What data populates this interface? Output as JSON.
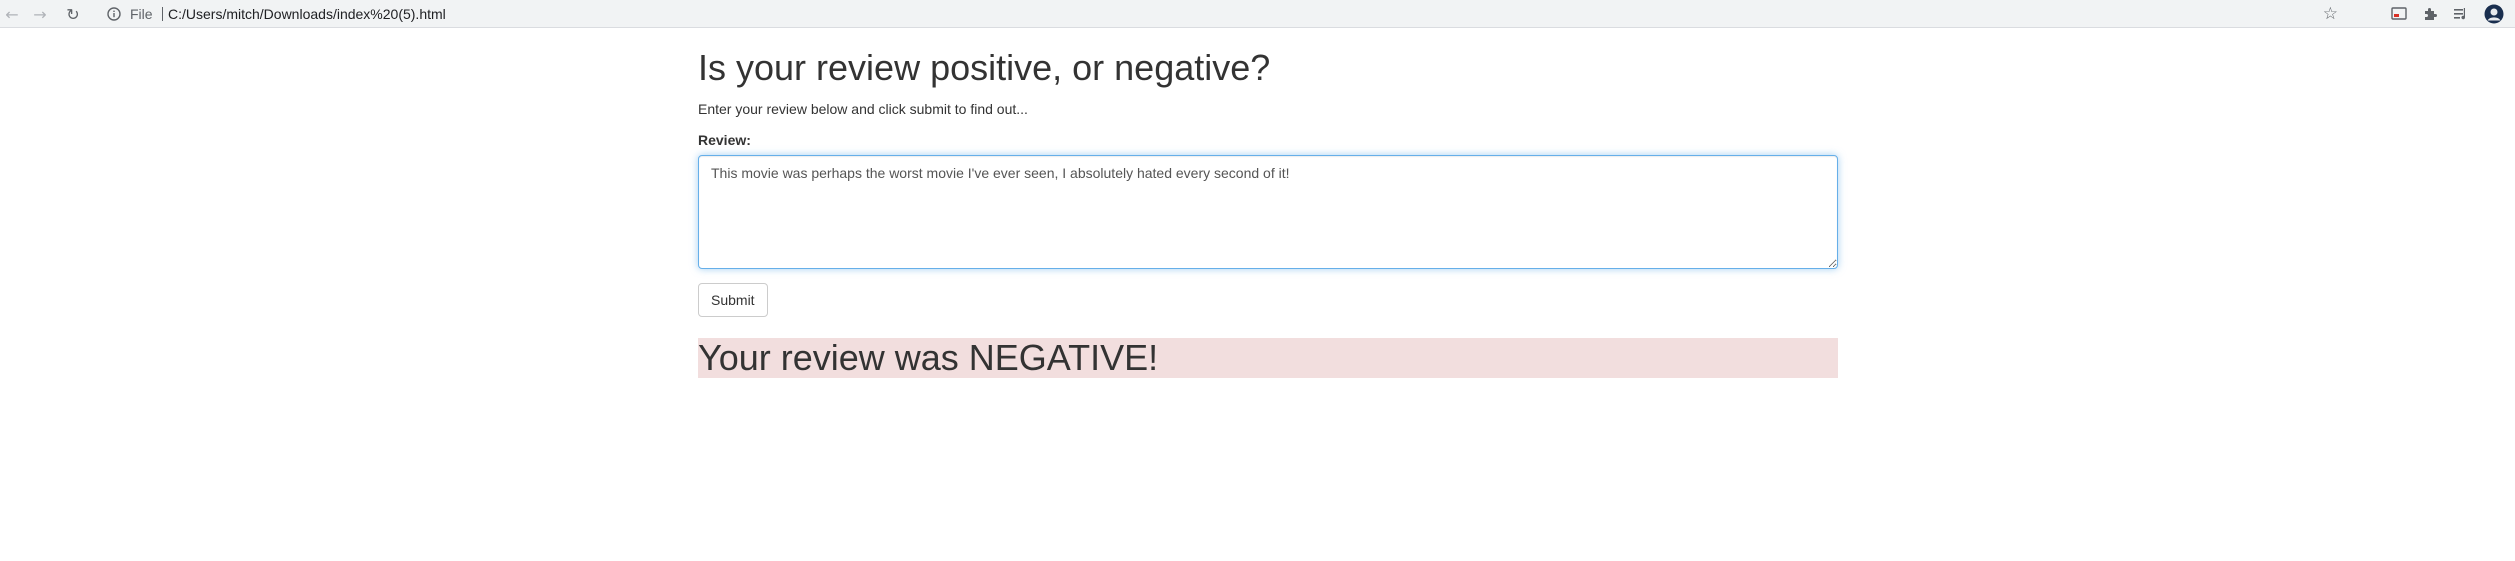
{
  "browser": {
    "url_scheme_label": "File",
    "url": "C:/Users/mitch/Downloads/index%20(5).html",
    "icons": {
      "back": "arrow-left-icon",
      "forward": "arrow-right-icon",
      "reload": "reload-icon",
      "info": "info-icon",
      "bookmark": "star-icon",
      "cast": "cast-icon",
      "extensions": "puzzle-icon",
      "reading_list": "reading-list-icon",
      "profile": "avatar-icon"
    }
  },
  "page": {
    "title": "Is your review positive, or negative?",
    "intro": "Enter your review below and click submit to find out...",
    "review_label": "Review:",
    "review_value": "This movie was perhaps the worst movie I've ever seen, I absolutely hated every second of it!",
    "submit_label": "Submit",
    "result": "Your review was NEGATIVE!",
    "colors": {
      "result_background": "#f2dede",
      "input_focus_border": "#66afe9"
    }
  }
}
